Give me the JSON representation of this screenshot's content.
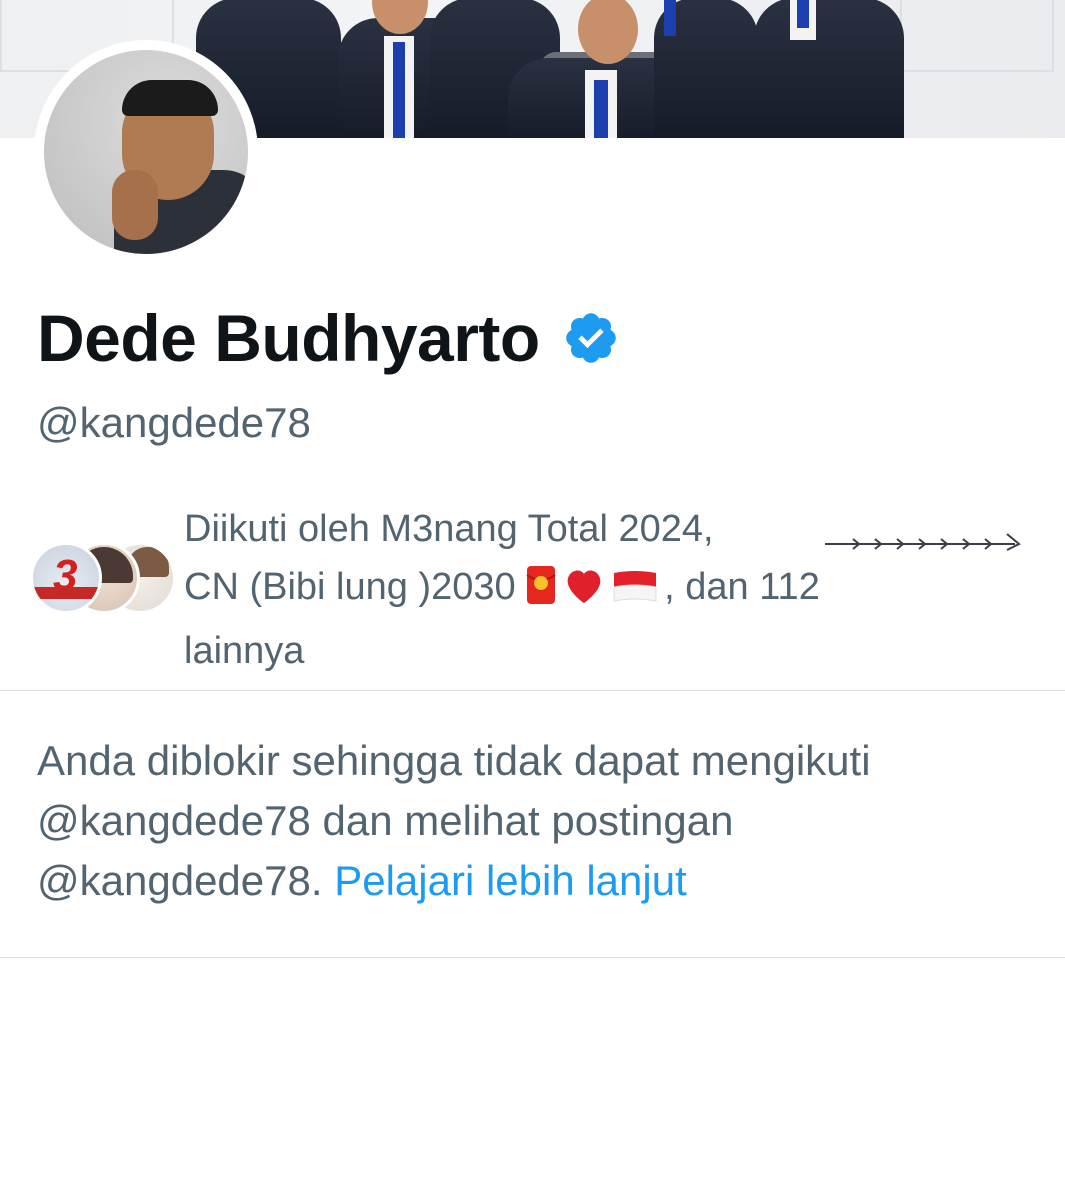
{
  "profile": {
    "display_name": "Dede Budhyarto",
    "handle": "@kangdede78",
    "verified_badge_icon": "verified-badge-icon",
    "verified_color": "#1d9bf0"
  },
  "followers_preview": {
    "line1": "Diikuti oleh M3nang Total 2024,",
    "line2_prefix": "CN (Bibi lung )2030",
    "line2_suffix": ", dan 112",
    "line3": "lainnya",
    "emoji_icons": [
      "red-envelope-icon",
      "red-heart-icon",
      "indonesia-flag-icon"
    ],
    "avatars": [
      "follower-avatar-1",
      "follower-avatar-2",
      "follower-avatar-3"
    ]
  },
  "blocked_notice": {
    "line1": "Anda diblokir sehingga tidak dapat mengikuti",
    "line2": "@kangdede78 dan melihat postingan",
    "line3_prefix": "@kangdede78.",
    "learn_more": "Pelajari lebih lanjut"
  },
  "colors": {
    "text_primary": "#0f1419",
    "text_secondary": "#536471",
    "link": "#1d9bf0",
    "divider": "#d7dde1"
  }
}
